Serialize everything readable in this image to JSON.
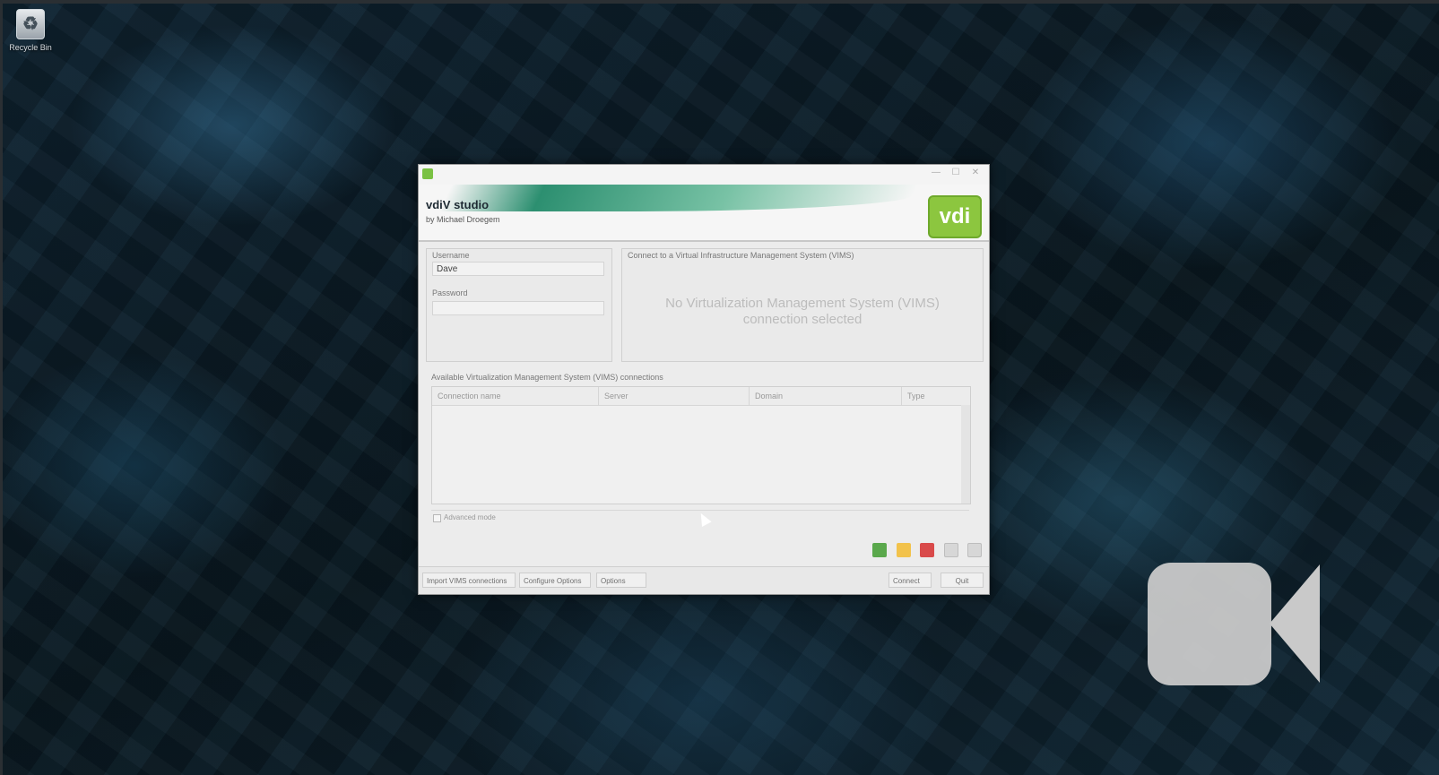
{
  "desktop": {
    "icon_label": "Recycle Bin"
  },
  "window": {
    "title": "",
    "app_name": "vdiV studio",
    "author": "by Michael Droegem",
    "logo_text": "vdi",
    "login": {
      "username_label": "Username",
      "username_value": "Dave",
      "password_label": "Password",
      "password_value": ""
    },
    "right_panel": {
      "header": "Connect to a Virtual Infrastructure Management System (VIMS)",
      "empty_message": "No Virtualization Management System (VIMS) connection selected"
    },
    "table": {
      "section_title": "Available Virtualization Management System (VIMS) connections",
      "columns": [
        "Connection name",
        "Server",
        "Domain",
        "Type"
      ]
    },
    "advanced_label": "Advanced mode",
    "bottom_buttons": {
      "import": "Import VIMS connections",
      "config": "Configure Options",
      "options": "Options",
      "connect": "Connect",
      "quit": "Quit"
    }
  },
  "icons": [
    "recycle-bin-icon",
    "app-icon",
    "add-icon",
    "edit-icon",
    "delete-icon",
    "nav-left-icon",
    "nav-right-icon",
    "video-camera-icon"
  ],
  "colors": {
    "accent_green": "#8cc63f",
    "swoosh_teal": "#2c8f70"
  }
}
